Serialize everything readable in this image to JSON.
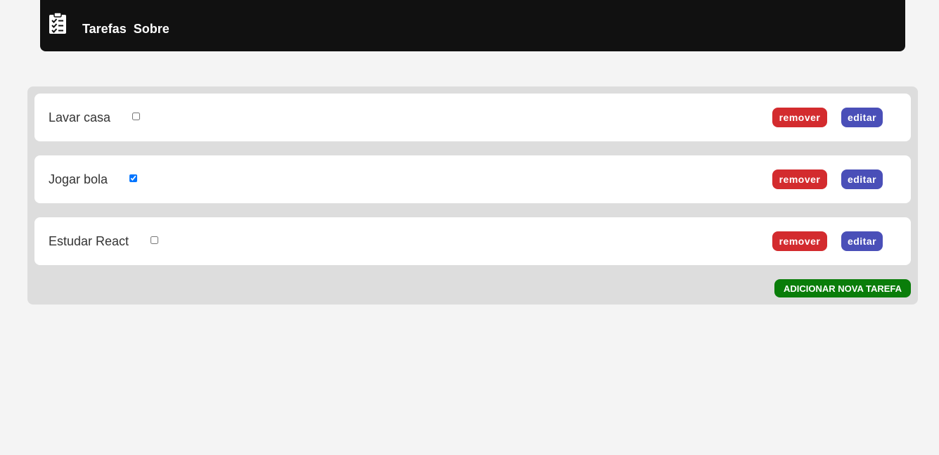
{
  "nav": {
    "icon": "clipboard-check-icon",
    "links": [
      "Tarefas",
      "Sobre"
    ]
  },
  "tasks": [
    {
      "label": "Lavar casa",
      "done": false
    },
    {
      "label": "Jogar bola",
      "done": true
    },
    {
      "label": "Estudar React",
      "done": false
    }
  ],
  "actions": {
    "remove_label": "remover",
    "edit_label": "editar",
    "add_label": "ADICIONAR NOVA TAREFA"
  },
  "colors": {
    "navbar": "#111111",
    "remove": "#d32b2e",
    "edit": "#4a4fb8",
    "add": "#0a7d0a"
  }
}
